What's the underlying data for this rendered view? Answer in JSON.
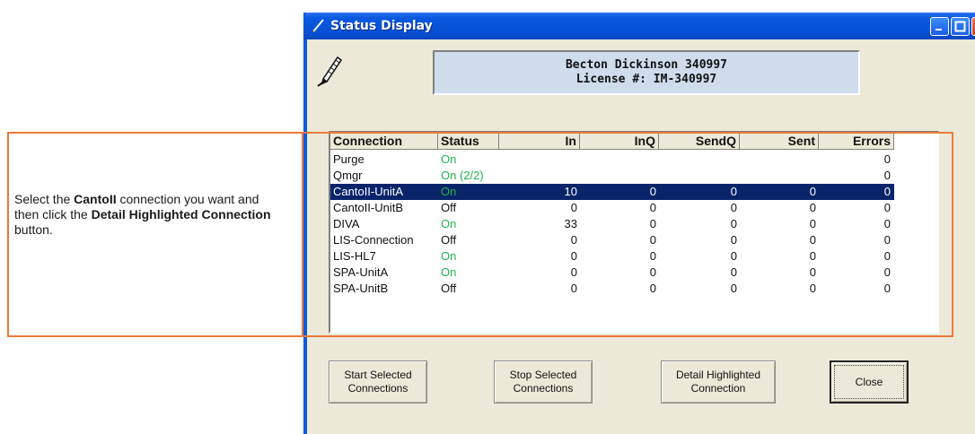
{
  "callout": {
    "line1_prefix": "Select the ",
    "line1_bold": "CantoII",
    "line1_suffix": " connection you want and then click the ",
    "line2_bold": "Detail Highlighted Connection",
    "line2_suffix": " button."
  },
  "window": {
    "title": "Status Display",
    "icon": "pen-icon"
  },
  "display": {
    "line1": "Becton Dickinson 340997",
    "line2": "License #: IM-340997"
  },
  "table": {
    "headers": [
      "Connection",
      "Status",
      "In",
      "InQ",
      "SendQ",
      "Sent",
      "Errors"
    ],
    "rows": [
      {
        "connection": "Purge",
        "status": "On",
        "in": "",
        "inq": "",
        "sendq": "",
        "sent": "",
        "errors": "0",
        "on": true
      },
      {
        "connection": "Qmgr",
        "status": "On (2/2)",
        "in": "",
        "inq": "",
        "sendq": "",
        "sent": "",
        "errors": "0",
        "on": true
      },
      {
        "connection": "CantoII-UnitA",
        "status": "On",
        "in": "10",
        "inq": "0",
        "sendq": "0",
        "sent": "0",
        "errors": "0",
        "on": true,
        "selected": true
      },
      {
        "connection": "CantoII-UnitB",
        "status": "Off",
        "in": "0",
        "inq": "0",
        "sendq": "0",
        "sent": "0",
        "errors": "0",
        "on": false
      },
      {
        "connection": "DIVA",
        "status": "On",
        "in": "33",
        "inq": "0",
        "sendq": "0",
        "sent": "0",
        "errors": "0",
        "on": true
      },
      {
        "connection": "LIS-Connection",
        "status": "Off",
        "in": "0",
        "inq": "0",
        "sendq": "0",
        "sent": "0",
        "errors": "0",
        "on": false
      },
      {
        "connection": "LIS-HL7",
        "status": "On",
        "in": "0",
        "inq": "0",
        "sendq": "0",
        "sent": "0",
        "errors": "0",
        "on": true
      },
      {
        "connection": "SPA-UnitA",
        "status": "On",
        "in": "0",
        "inq": "0",
        "sendq": "0",
        "sent": "0",
        "errors": "0",
        "on": true
      },
      {
        "connection": "SPA-UnitB",
        "status": "Off",
        "in": "0",
        "inq": "0",
        "sendq": "0",
        "sent": "0",
        "errors": "0",
        "on": false
      }
    ]
  },
  "buttons": {
    "start": "Start Selected Connections",
    "stop": "Stop Selected Connections",
    "detail": "Detail Highlighted Connection",
    "close": "Close"
  },
  "colors": {
    "status_on": "#22b14c",
    "selection": "#0a246a",
    "annotation": "#ec7a3c",
    "titlebar": "#0a58e0"
  }
}
